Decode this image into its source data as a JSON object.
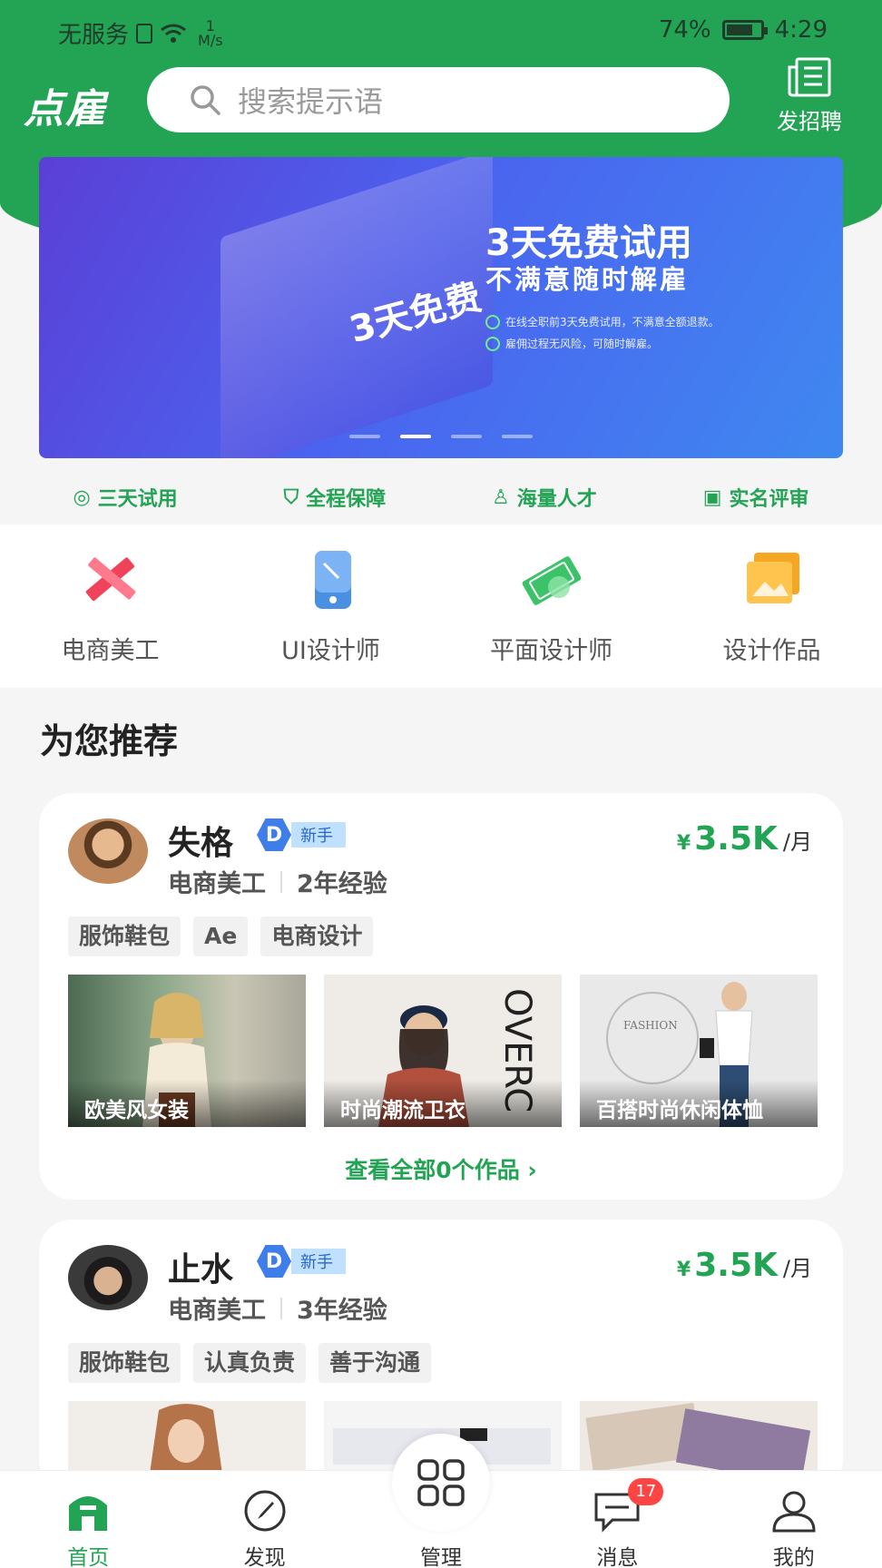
{
  "status": {
    "carrier": "无服务",
    "speed_value": "1",
    "speed_unit": "M/s",
    "battery": "74%",
    "time": "4:29"
  },
  "header": {
    "logo": "点雇",
    "search_placeholder": "搜索提示语",
    "post_job_label": "发招聘"
  },
  "banner": {
    "title": "3天免费试用",
    "subtitle": "不满意随时解雇",
    "line1": "在线全职前3天免费试用，不满意全额退款。",
    "line2": "雇佣过程无风险，可随时解雇。",
    "badge": "3天免费",
    "active_slide": 2,
    "slide_count": 4
  },
  "features": [
    {
      "label": "三天试用",
      "icon": "free-icon"
    },
    {
      "label": "全程保障",
      "icon": "shield-icon"
    },
    {
      "label": "海量人才",
      "icon": "person-icon"
    },
    {
      "label": "实名评审",
      "icon": "id-card-icon"
    }
  ],
  "categories": [
    {
      "label": "电商美工",
      "icon": "ruler-pencil-icon",
      "color": "#f0435a"
    },
    {
      "label": "UI设计师",
      "icon": "phone-icon",
      "color": "#4a90e2"
    },
    {
      "label": "平面设计师",
      "icon": "money-icon",
      "color": "#3cc36a"
    },
    {
      "label": "设计作品",
      "icon": "picture-icon",
      "color": "#f5a623"
    }
  ],
  "section_title": "为您推荐",
  "cards": [
    {
      "name": "失格",
      "level_letter": "D",
      "level_text": "新手",
      "role": "电商美工",
      "experience": "2年经验",
      "currency": "¥",
      "salary": "3.5K",
      "salary_unit": "/月",
      "tags": [
        "服饰鞋包",
        "Ae",
        "电商设计"
      ],
      "works": [
        "欧美风女装",
        "时尚潮流卫衣",
        "百搭时尚休闲体恤"
      ],
      "view_all": "查看全部0个作品 ›"
    },
    {
      "name": "止水",
      "level_letter": "D",
      "level_text": "新手",
      "role": "电商美工",
      "experience": "3年经验",
      "currency": "¥",
      "salary": "3.5K",
      "salary_unit": "/月",
      "tags": [
        "服饰鞋包",
        "认真负责",
        "善于沟通"
      ]
    }
  ],
  "bottom_nav": [
    {
      "label": "首页",
      "icon": "home-icon",
      "active": true
    },
    {
      "label": "发现",
      "icon": "compass-icon"
    },
    {
      "label": "管理",
      "icon": "grid-icon"
    },
    {
      "label": "消息",
      "icon": "message-icon",
      "badge": "17"
    },
    {
      "label": "我的",
      "icon": "user-icon"
    }
  ],
  "colors": {
    "brand": "#22a454",
    "badge": "#f44444"
  }
}
